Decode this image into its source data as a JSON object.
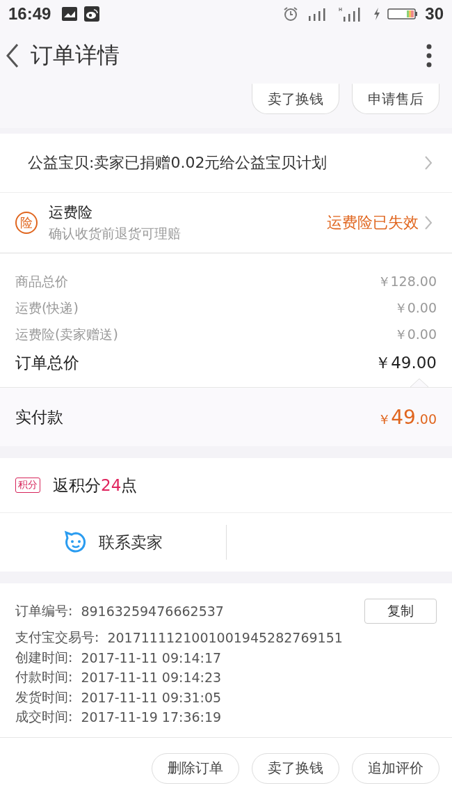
{
  "status_bar": {
    "time": "16:49",
    "battery": "30"
  },
  "header": {
    "title": "订单详情"
  },
  "top_actions": [
    "卖了换钱",
    "申请售后"
  ],
  "charity": {
    "text": "公益宝贝:卖家已捐赠0.02元给公益宝贝计划"
  },
  "insurance": {
    "badge": "险",
    "title": "运费险",
    "subtitle": "确认收货前退货可理赔",
    "status": "运费险已失效"
  },
  "prices": [
    {
      "label": "商品总价",
      "amount": "￥128.00",
      "kind": "minor"
    },
    {
      "label": "运费(快递)",
      "amount": "￥0.00",
      "kind": "minor"
    },
    {
      "label": "运费险(卖家赠送)",
      "amount": "￥0.00",
      "kind": "minor"
    },
    {
      "label": "订单总价",
      "amount": "￥49.00",
      "kind": "total"
    }
  ],
  "paid": {
    "label": "实付款",
    "currency": "￥",
    "integer": "49",
    "decimal": ".00"
  },
  "points": {
    "badge": "积分",
    "prefix": "返积分",
    "value": "24",
    "suffix": "点"
  },
  "contact": {
    "label": "联系卖家"
  },
  "info": [
    {
      "label": "订单编号:",
      "value": "89163259476662537",
      "action": "复制"
    },
    {
      "label": "支付宝交易号:",
      "value": "2017111121001001945282769151"
    },
    {
      "label": "创建时间:",
      "value": "2017-11-11 09:14:17"
    },
    {
      "label": "付款时间:",
      "value": "2017-11-11 09:14:23"
    },
    {
      "label": "发货时间:",
      "value": "2017-11-11 09:31:05"
    },
    {
      "label": "成交时间:",
      "value": "2017-11-19 17:36:19"
    }
  ],
  "bottom_actions": [
    "删除订单",
    "卖了换钱",
    "追加评价"
  ]
}
